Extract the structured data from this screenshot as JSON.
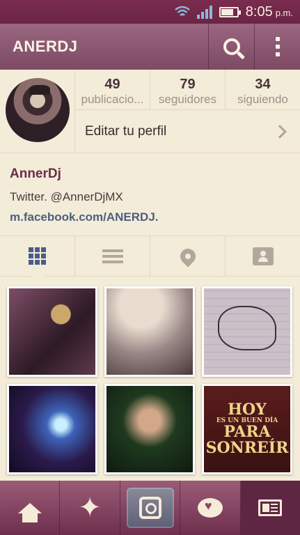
{
  "status_bar": {
    "time": "8:05",
    "ampm": "p.m.",
    "battery_level": 0.7
  },
  "header": {
    "title": "ANERDJ",
    "search_icon": "search-icon",
    "menu_icon": "overflow-menu-icon"
  },
  "profile": {
    "stats": [
      {
        "value": "49",
        "label": "publicacio..."
      },
      {
        "value": "79",
        "label": "seguidores"
      },
      {
        "value": "34",
        "label": "siguiendo"
      }
    ],
    "edit_label": "Editar tu perfil",
    "name": "AnnerDj",
    "bio_line": "Twitter. @AnnerDjMX",
    "link": "m.facebook.com/ANERDJ."
  },
  "photo6": {
    "line1": "HOY",
    "line2": "ES UN BUEN DÍA",
    "line3": "PARA",
    "line4": "SONREÍR"
  },
  "colors": {
    "accent": "#7a2c4e",
    "link": "#4d5f7e",
    "name": "#6a2e4a"
  }
}
